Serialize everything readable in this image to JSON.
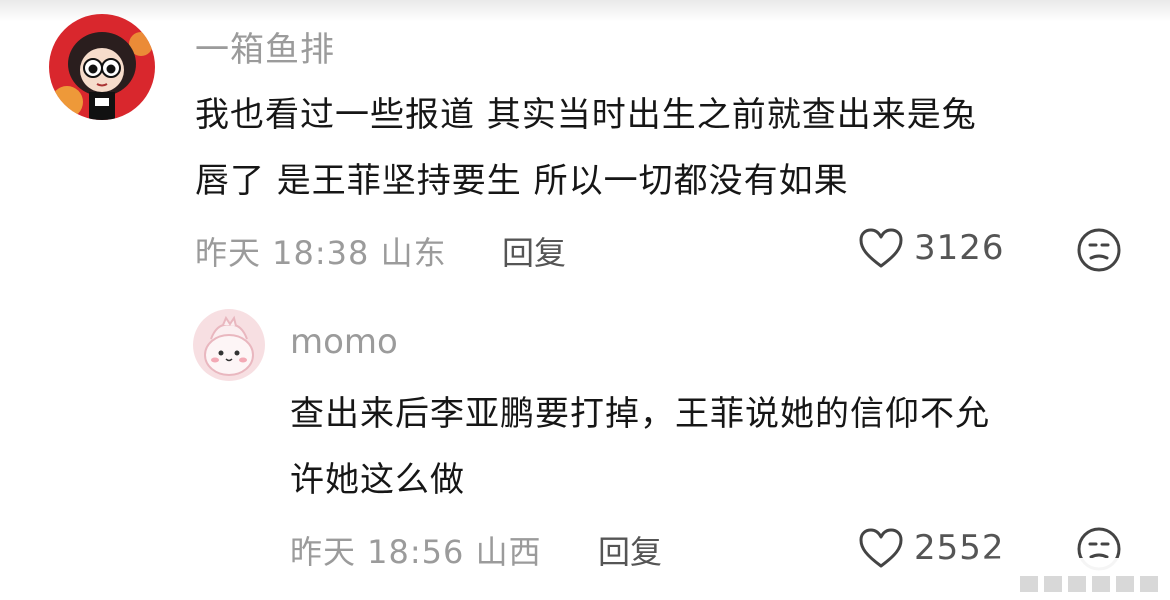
{
  "comments": [
    {
      "username": "一箱鱼排",
      "lines": [
        "我也看过一些报道 其实当时出生之前就查出来是兔",
        "唇了 是王菲坚持要生 所以一切都没有如果"
      ],
      "time": "昨天 18:38",
      "location": "山东",
      "reply_label": "回复",
      "likes": "3126",
      "like_icon": "heart-outline-icon",
      "dislike_icon": "frown-face-icon"
    },
    {
      "username": "momo",
      "lines": [
        "查出来后李亚鹏要打掉，王菲说她的信仰不允",
        "许她这么做"
      ],
      "time": "昨天 18:56",
      "location": "山西",
      "reply_label": "回复",
      "likes": "2552",
      "like_icon": "heart-outline-icon",
      "dislike_icon": "frown-face-icon"
    }
  ]
}
